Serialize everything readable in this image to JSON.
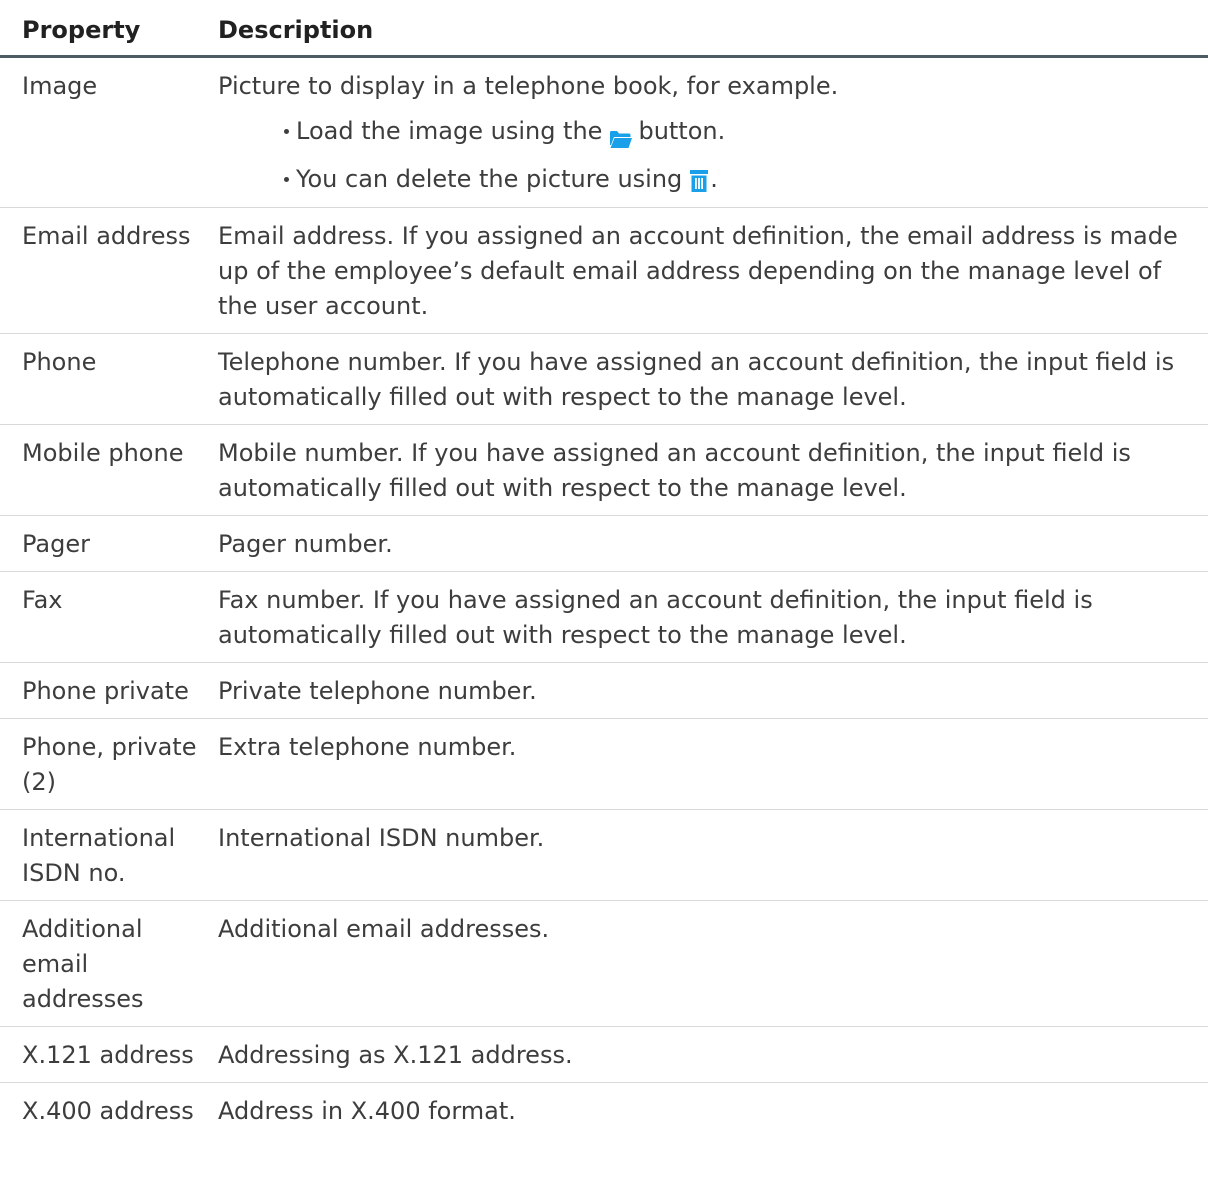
{
  "header": {
    "property": "Property",
    "description": "Description"
  },
  "rows": [
    {
      "property": "Image",
      "description": "Picture to display in a telephone book, for example.",
      "bullets": [
        {
          "before": "Load the image using the",
          "icon": "folder-open-icon",
          "after": "button."
        },
        {
          "before": "You can delete the picture using",
          "icon": "trash-icon",
          "after": "."
        }
      ]
    },
    {
      "property": "Email address",
      "description": "Email address. If you assigned an account definition, the email address is made up of the employee’s default email address depending on the manage level of the user account."
    },
    {
      "property": "Phone",
      "description": "Telephone number. If you have assigned an account definition, the input field is automatically filled out with respect to the manage level."
    },
    {
      "property": "Mobile phone",
      "description": "Mobile number. If you have assigned an account definition, the input field is automatically filled out with respect to the manage level."
    },
    {
      "property": "Pager",
      "description": "Pager number."
    },
    {
      "property": "Fax",
      "description": "Fax number. If you have assigned an account definition, the input field is automatically filled out with respect to the manage level."
    },
    {
      "property": "Phone private",
      "description": "Private telephone number."
    },
    {
      "property": "Phone, private (2)",
      "description": "Extra telephone number."
    },
    {
      "property": "International ISDN no.",
      "description": "International ISDN number."
    },
    {
      "property": "Additional email addresses",
      "description": "Additional email addresses."
    },
    {
      "property": "X.121 address",
      "description": "Addressing as X.121 address."
    },
    {
      "property": "X.400 address",
      "description": "Address in X.400 format."
    }
  ],
  "colors": {
    "icon_blue": "#1aa0e8",
    "header_rule": "#4e5b63",
    "row_rule": "#d9d9d9",
    "text": "#3d3d3d"
  }
}
